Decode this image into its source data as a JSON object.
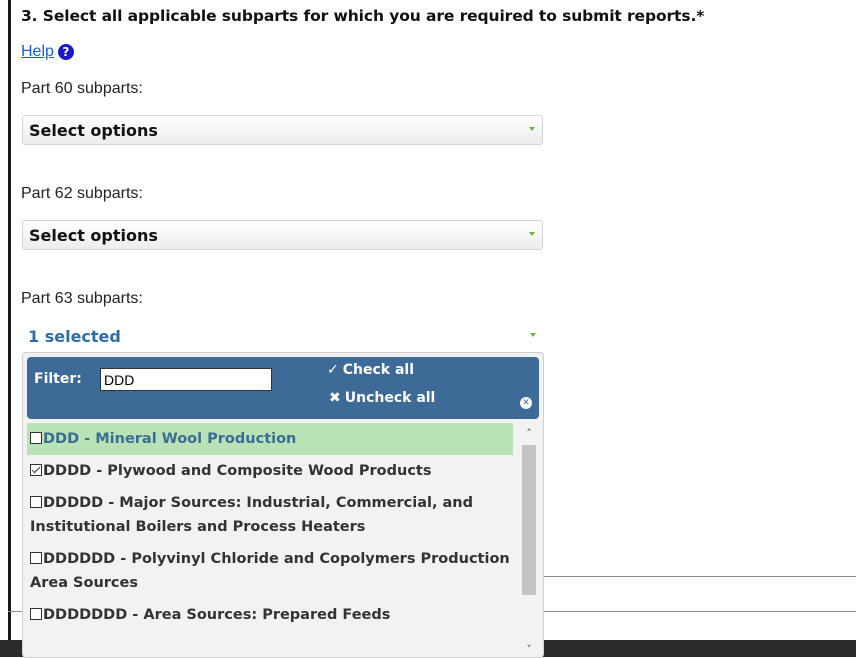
{
  "question": {
    "title": "3. Select all applicable subparts for which you are required to submit reports.*"
  },
  "help": {
    "label": "Help",
    "icon": "question-circle-icon",
    "icon_glyph": "?"
  },
  "part60": {
    "label": "Part 60 subparts:",
    "value": "Select options"
  },
  "part62": {
    "label": "Part 62 subparts:",
    "value": "Select options"
  },
  "part63": {
    "label": "Part 63 subparts:",
    "value": "1 selected",
    "menu": {
      "filter_label": "Filter:",
      "filter_value": "DDD",
      "check_all": {
        "icon": "checkmark-icon",
        "glyph": "✓",
        "label": "Check all"
      },
      "uncheck_all": {
        "icon": "x-icon",
        "glyph": "✖",
        "label": "Uncheck all"
      },
      "close": {
        "icon": "close-circle-icon",
        "glyph": "✕"
      },
      "options": [
        {
          "label": "DDD - Mineral Wool Production",
          "checked": false,
          "highlighted": true
        },
        {
          "label": "DDDD - Plywood and Composite Wood Products",
          "checked": true,
          "highlighted": false
        },
        {
          "label": "DDDDD - Major Sources: Industrial, Commercial, and Institutional Boilers and Process Heaters",
          "checked": false,
          "highlighted": false
        },
        {
          "label": "DDDDDD - Polyvinyl Chloride and Copolymers Production Area Sources",
          "checked": false,
          "highlighted": false
        },
        {
          "label": "DDDDDDD - Area Sources: Prepared Feeds",
          "checked": false,
          "highlighted": false
        }
      ],
      "scroll": {
        "up_icon": "chevron-up-icon",
        "up_glyph": "˄",
        "down_icon": "chevron-down-icon",
        "down_glyph": "˅"
      }
    }
  },
  "colors": {
    "menu_header": "#3d6a97",
    "highlight": "#b9e2b7",
    "link": "#1a5fc4",
    "selected_text": "#2f6ea5",
    "caret": "#6db33f"
  }
}
